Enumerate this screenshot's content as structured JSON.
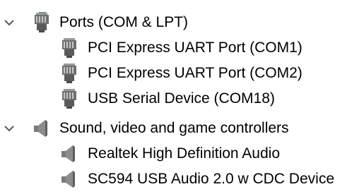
{
  "tree": {
    "ports": {
      "expanded": true,
      "icon": "port-connector-icon",
      "label": "Ports (COM & LPT)",
      "children": [
        {
          "label": "PCI Express UART Port (COM1)",
          "icon": "port-connector-icon"
        },
        {
          "label": "PCI Express UART Port (COM2)",
          "icon": "port-connector-icon"
        },
        {
          "label": "USB Serial Device (COM18)",
          "icon": "port-connector-icon"
        }
      ]
    },
    "sound": {
      "expanded": true,
      "icon": "speaker-icon",
      "label": "Sound, video and game controllers",
      "children": [
        {
          "label": "Realtek High Definition Audio",
          "icon": "speaker-icon"
        },
        {
          "label": "SC594 USB Audio 2.0 w CDC Device",
          "icon": "speaker-icon"
        }
      ]
    }
  },
  "colors": {
    "accent_green": "#2fa84f",
    "icon_gray": "#6f6f6f",
    "chevron": "#5a5a5a"
  }
}
